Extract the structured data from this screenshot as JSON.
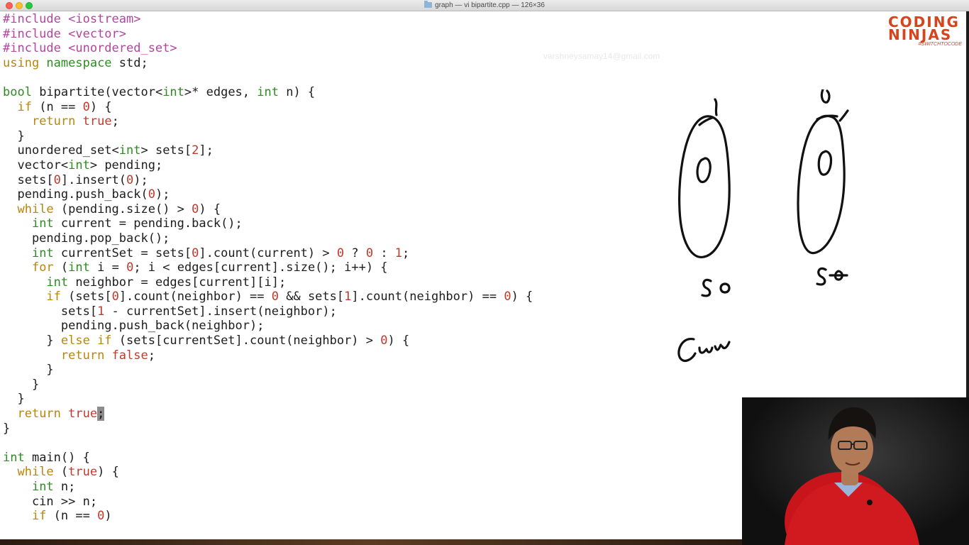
{
  "window": {
    "title": "graph — vi bipartite.cpp — 126×36"
  },
  "watermark": "varshneysamay14@gmail.com",
  "logo": {
    "line1": "CODING",
    "line2": "NINJAS",
    "tagline": "#SWITCHTOCODE"
  },
  "code": {
    "lines": [
      [
        [
          "pp",
          "#include <iostream>"
        ]
      ],
      [
        [
          "pp",
          "#include <vector>"
        ]
      ],
      [
        [
          "pp",
          "#include <unordered_set>"
        ]
      ],
      [
        [
          "kw",
          "using"
        ],
        [
          "",
          ""
        ],
        [
          "",
          ""
        ],
        [
          "ty",
          " namespace"
        ],
        [
          "",
          " std;"
        ]
      ],
      [
        [
          "",
          ""
        ]
      ],
      [
        [
          "ty",
          "bool"
        ],
        [
          "",
          " bipartite(vector<"
        ],
        [
          "ty",
          "int"
        ],
        [
          "",
          ">* edges, "
        ],
        [
          "ty",
          "int"
        ],
        [
          "",
          " n) {"
        ]
      ],
      [
        [
          "",
          "  "
        ],
        [
          "kw",
          "if"
        ],
        [
          "",
          " (n == "
        ],
        [
          "nm",
          "0"
        ],
        [
          "",
          ") {"
        ]
      ],
      [
        [
          "",
          "    "
        ],
        [
          "kw",
          "return"
        ],
        [
          "",
          " "
        ],
        [
          "st",
          "true"
        ],
        [
          "",
          ";"
        ]
      ],
      [
        [
          "",
          "  }"
        ]
      ],
      [
        [
          "",
          "  unordered_set<"
        ],
        [
          "ty",
          "int"
        ],
        [
          "",
          "> sets["
        ],
        [
          "nm",
          "2"
        ],
        [
          "",
          "];"
        ]
      ],
      [
        [
          "",
          "  vector<"
        ],
        [
          "ty",
          "int"
        ],
        [
          "",
          "> pending;"
        ]
      ],
      [
        [
          "",
          "  sets["
        ],
        [
          "nm",
          "0"
        ],
        [
          "",
          "].insert("
        ],
        [
          "nm",
          "0"
        ],
        [
          "",
          ");"
        ]
      ],
      [
        [
          "",
          "  pending.push_back("
        ],
        [
          "nm",
          "0"
        ],
        [
          "",
          ");"
        ]
      ],
      [
        [
          "",
          "  "
        ],
        [
          "kw",
          "while"
        ],
        [
          "",
          " (pending.size() > "
        ],
        [
          "nm",
          "0"
        ],
        [
          "",
          ") {"
        ]
      ],
      [
        [
          "",
          "    "
        ],
        [
          "ty",
          "int"
        ],
        [
          "",
          " current = pending.back();"
        ]
      ],
      [
        [
          "",
          "    pending.pop_back();"
        ]
      ],
      [
        [
          "",
          "    "
        ],
        [
          "ty",
          "int"
        ],
        [
          "",
          " currentSet = sets["
        ],
        [
          "nm",
          "0"
        ],
        [
          "",
          "].count(current) > "
        ],
        [
          "nm",
          "0"
        ],
        [
          "",
          " ? "
        ],
        [
          "nm",
          "0"
        ],
        [
          "",
          " : "
        ],
        [
          "nm",
          "1"
        ],
        [
          "",
          ";"
        ]
      ],
      [
        [
          "",
          "    "
        ],
        [
          "kw",
          "for"
        ],
        [
          "",
          " ("
        ],
        [
          "ty",
          "int"
        ],
        [
          "",
          " i = "
        ],
        [
          "nm",
          "0"
        ],
        [
          "",
          "; i < edges[current].size(); i++) {"
        ]
      ],
      [
        [
          "",
          "      "
        ],
        [
          "ty",
          "int"
        ],
        [
          "",
          " neighbor = edges[current][i];"
        ]
      ],
      [
        [
          "",
          "      "
        ],
        [
          "kw",
          "if"
        ],
        [
          "",
          " (sets["
        ],
        [
          "nm",
          "0"
        ],
        [
          "",
          "].count(neighbor) == "
        ],
        [
          "nm",
          "0"
        ],
        [
          "",
          " && sets["
        ],
        [
          "nm",
          "1"
        ],
        [
          "",
          "].count(neighbor) == "
        ],
        [
          "nm",
          "0"
        ],
        [
          "",
          ") {"
        ]
      ],
      [
        [
          "",
          "        sets["
        ],
        [
          "nm",
          "1"
        ],
        [
          "",
          " - currentSet].insert(neighbor);"
        ]
      ],
      [
        [
          "",
          "        pending.push_back(neighbor);"
        ]
      ],
      [
        [
          "",
          "      } "
        ],
        [
          "kw",
          "else if"
        ],
        [
          "",
          " (sets[currentSet].count(neighbor) > "
        ],
        [
          "nm",
          "0"
        ],
        [
          "",
          ") {"
        ]
      ],
      [
        [
          "",
          "        "
        ],
        [
          "kw",
          "return"
        ],
        [
          "",
          " "
        ],
        [
          "st",
          "false"
        ],
        [
          "",
          ";"
        ]
      ],
      [
        [
          "",
          "      }"
        ]
      ],
      [
        [
          "",
          "    }"
        ]
      ],
      [
        [
          "",
          "  }"
        ]
      ],
      [
        [
          "",
          "  "
        ],
        [
          "kw",
          "return"
        ],
        [
          "",
          " "
        ],
        [
          "st",
          "true"
        ],
        [
          "cursor",
          ";"
        ]
      ],
      [
        [
          "",
          "}"
        ]
      ],
      [
        [
          "",
          ""
        ]
      ],
      [
        [
          "ty",
          "int"
        ],
        [
          "",
          " main() {"
        ]
      ],
      [
        [
          "",
          "  "
        ],
        [
          "kw",
          "while"
        ],
        [
          "",
          " ("
        ],
        [
          "st",
          "true"
        ],
        [
          "",
          ") {"
        ]
      ],
      [
        [
          "",
          "    "
        ],
        [
          "ty",
          "int"
        ],
        [
          "",
          " n;"
        ]
      ],
      [
        [
          "",
          "    cin >> n;"
        ]
      ],
      [
        [
          "",
          "    "
        ],
        [
          "kw",
          "if"
        ],
        [
          "",
          " (n == "
        ],
        [
          "nm",
          "0"
        ],
        [
          "",
          ")"
        ]
      ]
    ]
  },
  "sketch": {
    "set0_label": "S0",
    "set1_label": "S1",
    "node0": "0",
    "node1": "0",
    "curr_label": "Curr"
  }
}
